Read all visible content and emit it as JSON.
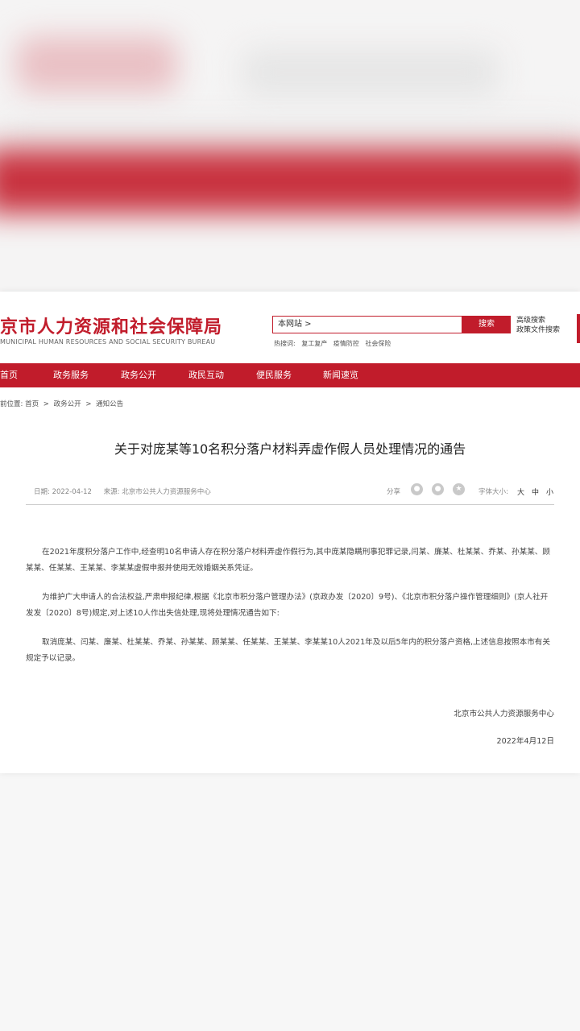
{
  "header": {
    "logo_text": "京市人力资源和社会保障局",
    "logo_en": "MUNICIPAL HUMAN RESOURCES AND SOCIAL SECURITY BUREAU",
    "search_scope": "本网站 >",
    "search_button": "搜索",
    "adv_search": "高级搜索",
    "policy_search": "政策文件搜索",
    "hot_label": "热搜词:",
    "hot_terms": [
      "复工复产",
      "疫情防控",
      "社会保险"
    ]
  },
  "nav": {
    "items": [
      "首页",
      "政务服务",
      "政务公开",
      "政民互动",
      "便民服务",
      "新闻速览"
    ]
  },
  "breadcrumb": {
    "prefix": "前位置:",
    "items": [
      "首页",
      "政务公开",
      "通知公告"
    ],
    "separator": ">"
  },
  "article": {
    "title": "关于对庞某等10名积分落户材料弄虚作假人员处理情况的通告",
    "date": "日期: 2022-04-12",
    "source": "来源: 北京市公共人力资源服务中心",
    "share_label": "分享",
    "share_icons": [
      "wechat-icon",
      "weibo-icon",
      "favorite-icon"
    ],
    "font_size_label": "字体大小:",
    "font_sizes": [
      "大",
      "中",
      "小"
    ],
    "paragraphs": [
      "在2021年度积分落户工作中,经查明10名申请人存在积分落户材料弄虚作假行为,其中庞某隐瞒刑事犯罪记录,闫某、廉某、杜某某、乔某、孙某某、顾某某、任某某、王某某、李某某虚假申报并使用无效婚姻关系凭证。",
      "为维护广大申请人的合法权益,严肃申报纪律,根据《北京市积分落户管理办法》(京政办发〔2020〕9号)、《北京市积分落户操作管理细则》(京人社开发发〔2020〕8号)规定,对上述10人作出失信处理,现将处理情况通告如下:",
      "取消庞某、闫某、廉某、杜某某、乔某、孙某某、顾某某、任某某、王某某、李某某10人2021年及以后5年内的积分落户资格,上述信息按照本市有关规定予以记录。"
    ],
    "signature": "北京市公共人力资源服务中心",
    "sign_date": "2022年4月12日"
  },
  "colors": {
    "brand_red": "#c11c2b"
  }
}
